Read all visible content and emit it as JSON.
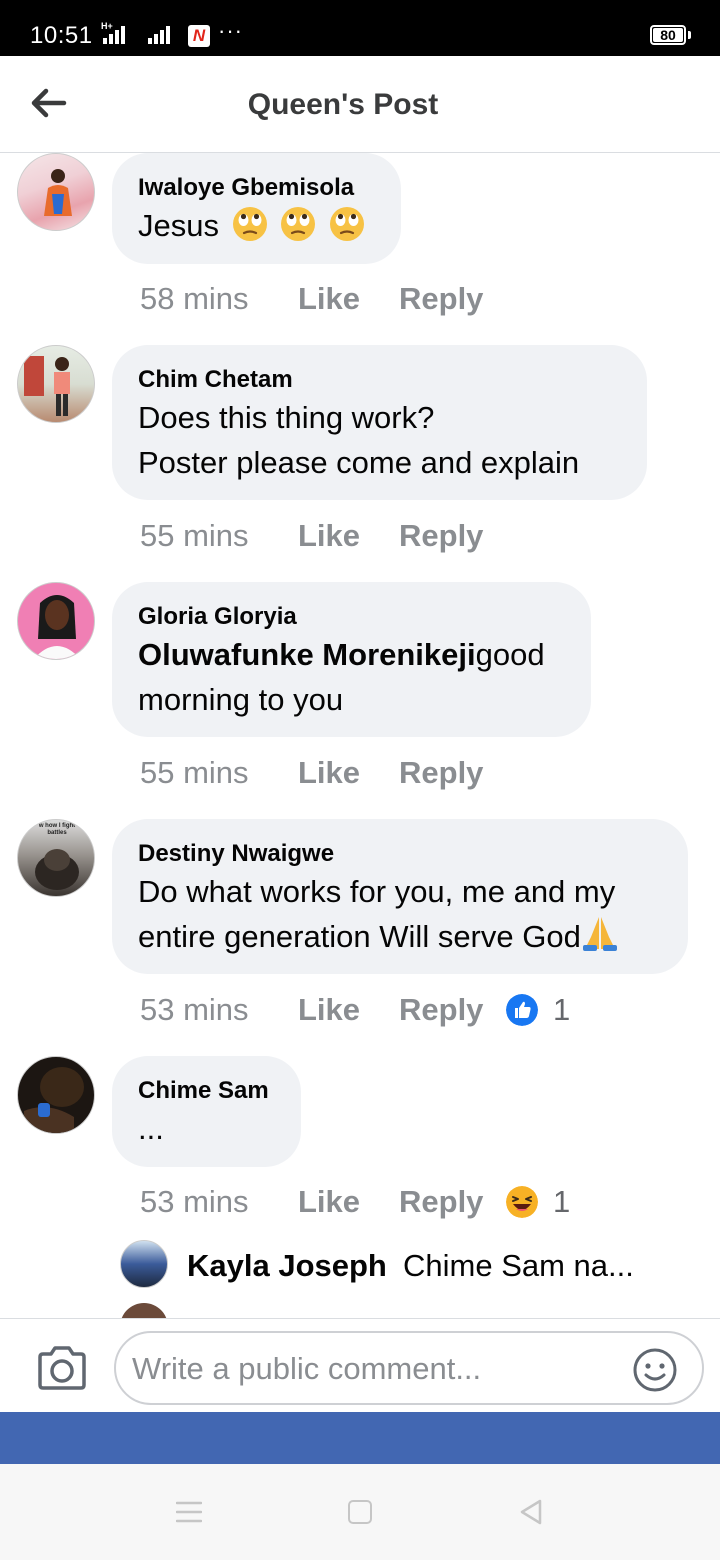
{
  "status_bar": {
    "time": "10:51",
    "network": "H+",
    "notification_app": "N",
    "more": "···",
    "battery": "80"
  },
  "header": {
    "title": "Queen's Post",
    "back_icon": "arrow-left-icon"
  },
  "comments": [
    {
      "author": "Iwaloye Gbemisola",
      "text": "Jesus",
      "emoji": [
        "face-with-rolling-eyes",
        "face-with-rolling-eyes",
        "face-with-rolling-eyes"
      ],
      "time": "58 mins",
      "like": "Like",
      "reply": "Reply"
    },
    {
      "author": "Chim Chetam",
      "text_line1": "Does this thing work?",
      "text_line2": "Poster please come and explain",
      "time": "55 mins",
      "like": "Like",
      "reply": "Reply"
    },
    {
      "author": "Gloria Gloryia",
      "mention": "Oluwafunke Morenikeji",
      "text_after_mention": "good",
      "text_line2": "morning to you",
      "time": "55 mins",
      "like": "Like",
      "reply": "Reply"
    },
    {
      "author": "Destiny Nwaigwe",
      "avatar_caption": "w how I fight battles",
      "text_line1": "Do what works for you, me and my",
      "text_line2": "entire generation Will serve God",
      "emoji": "folded-hands",
      "time": "53 mins",
      "like": "Like",
      "reply": "Reply",
      "reaction": "like",
      "reaction_icon": "thumbs-up-icon",
      "reaction_count": "1"
    },
    {
      "author": "Chime Sam",
      "text": "...",
      "time": "53 mins",
      "like": "Like",
      "reply": "Reply",
      "reaction": "haha",
      "reaction_icon": "laughing-face-icon",
      "reaction_count": "1"
    }
  ],
  "reply_preview": {
    "author": "Kayla Joseph",
    "text": "Chime Sam na..."
  },
  "composer": {
    "placeholder": "Write a public comment...",
    "camera_icon": "camera-icon",
    "emoji_icon": "smiley-icon"
  },
  "colors": {
    "bubble": "#f0f2f5",
    "meta_text": "#8a8d91",
    "brand_blue": "#4267b2",
    "like_blue": "#1877f2",
    "haha_yellow": "#f7b125"
  }
}
